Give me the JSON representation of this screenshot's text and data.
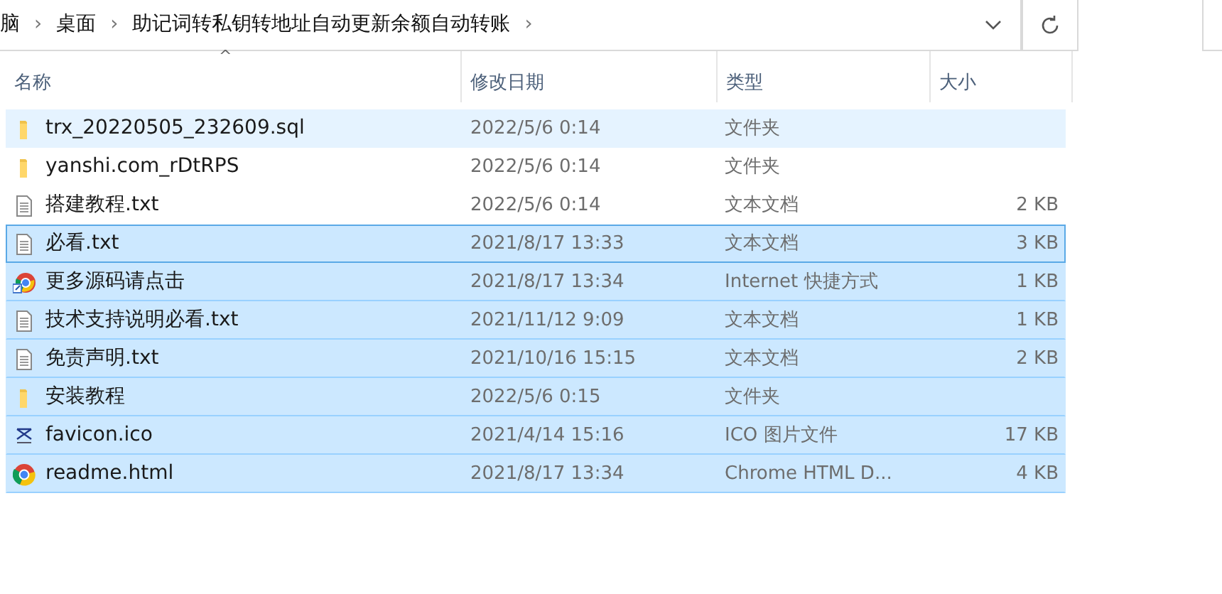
{
  "address_bar": {
    "crumbs": [
      "脑",
      "桌面",
      "助记词转私钥转地址自动更新余额自动转账"
    ],
    "separator": "›"
  },
  "columns": [
    "名称",
    "修改日期",
    "类型",
    "大小"
  ],
  "sort_mark": "^",
  "rows": [
    {
      "kind": "folder",
      "name": "trx_20220505_232609.sql",
      "date": "2022/5/6 0:14",
      "type": "文件夹",
      "size": "",
      "selected": false,
      "hovered": true,
      "focused": false
    },
    {
      "kind": "folder",
      "name": "yanshi.com_rDtRPS",
      "date": "2022/5/6 0:14",
      "type": "文件夹",
      "size": "",
      "selected": false,
      "hovered": false,
      "focused": false
    },
    {
      "kind": "text",
      "name": "搭建教程.txt",
      "date": "2022/5/6 0:14",
      "type": "文本文档",
      "size": "2 KB",
      "selected": false,
      "hovered": false,
      "focused": false
    },
    {
      "kind": "text",
      "name": "必看.txt",
      "date": "2021/8/17 13:33",
      "type": "文本文档",
      "size": "3 KB",
      "selected": true,
      "hovered": false,
      "focused": true
    },
    {
      "kind": "shortcut",
      "name": "更多源码请点击",
      "date": "2021/8/17 13:34",
      "type": "Internet 快捷方式",
      "size": "1 KB",
      "selected": true,
      "hovered": false,
      "focused": false
    },
    {
      "kind": "text",
      "name": "技术支持说明必看.txt",
      "date": "2021/11/12 9:09",
      "type": "文本文档",
      "size": "1 KB",
      "selected": true,
      "hovered": false,
      "focused": false
    },
    {
      "kind": "text",
      "name": "免责声明.txt",
      "date": "2021/10/16 15:15",
      "type": "文本文档",
      "size": "2 KB",
      "selected": true,
      "hovered": false,
      "focused": false
    },
    {
      "kind": "folder",
      "name": "安装教程",
      "date": "2022/5/6 0:15",
      "type": "文件夹",
      "size": "",
      "selected": true,
      "hovered": false,
      "focused": false
    },
    {
      "kind": "ico",
      "name": "favicon.ico",
      "date": "2021/4/14 15:16",
      "type": "ICO 图片文件",
      "size": "17 KB",
      "selected": true,
      "hovered": false,
      "focused": false
    },
    {
      "kind": "html",
      "name": "readme.html",
      "date": "2021/8/17 13:34",
      "type": "Chrome HTML D...",
      "size": "4 KB",
      "selected": true,
      "hovered": false,
      "focused": false
    }
  ]
}
